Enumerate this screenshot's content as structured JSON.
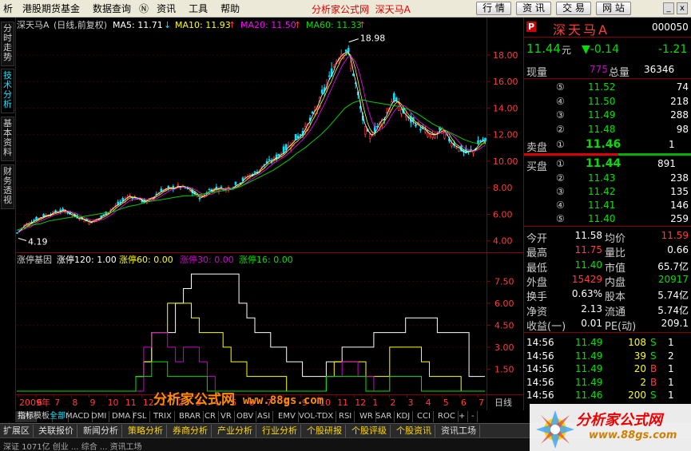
{
  "menu": {
    "items": [
      "析",
      "港股期货基金",
      "数据查询",
      "资讯",
      "工具",
      "帮助"
    ],
    "center_title": "分析家公式网",
    "center_stock": "深天马A",
    "buttons": [
      "行 情",
      "资 讯",
      "交 易",
      "网 站"
    ],
    "win_controls": [
      "_",
      "x"
    ]
  },
  "left_tabs": [
    "分时走势",
    "技术分析",
    "基本资料",
    "财务透视"
  ],
  "main_header": {
    "name": "深天马A",
    "type": "(日线,前复权)",
    "ma5": "MA5: 11.71",
    "ma10": "MA10: 11.93",
    "ma20": "MA20: 11.50",
    "ma60": "MA60: 11.33"
  },
  "price_axis": [
    "18.00",
    "16.00",
    "14.00",
    "12.00",
    "10.00",
    "8.00",
    "6.00",
    "4.00"
  ],
  "high_label": "18.98",
  "low_label": "4.19",
  "lower_header": {
    "title": "涨停基因",
    "l1": "涨停120: 1.00",
    "l2": "涨停60: 0.00",
    "l3": "涨停30: 0.00",
    "l4": "涨停16: 0.00"
  },
  "lower_axis": [
    "7.50",
    "6.00",
    "4.50",
    "3.00",
    "1.50"
  ],
  "date_axis": [
    "2009年",
    "6",
    "7",
    "8",
    "9",
    "10",
    "11",
    "12",
    "1",
    "2",
    "3",
    "4",
    "5",
    "6",
    "7",
    "8",
    "9",
    "10",
    "11",
    "12",
    "1",
    "2",
    "3",
    "4",
    "5",
    "6",
    "7"
  ],
  "period_label": "日线",
  "right_panel": {
    "code_badge": "P",
    "stock_name": "深天马A",
    "stock_code": "000050",
    "price": "11.44",
    "price_unit": "元",
    "change": "▼-0.14",
    "pct": "-1.21",
    "vol_label": "现量",
    "vol_now": "775",
    "total_label": "总量",
    "vol_total": "36346",
    "asks": [
      {
        "lv": "⑤",
        "p": "11.52",
        "v": "74"
      },
      {
        "lv": "④",
        "p": "11.50",
        "v": "218"
      },
      {
        "lv": "③",
        "p": "11.49",
        "v": "288"
      },
      {
        "lv": "②",
        "p": "11.48",
        "v": "98"
      }
    ],
    "sell1": {
      "label": "卖盘",
      "lv": "①",
      "p": "11.46",
      "v": "1"
    },
    "buy1": {
      "label": "买盘",
      "lv": "①",
      "p": "11.44",
      "v": "891"
    },
    "bids": [
      {
        "lv": "②",
        "p": "11.43",
        "v": "238"
      },
      {
        "lv": "③",
        "p": "11.42",
        "v": "135"
      },
      {
        "lv": "④",
        "p": "11.41",
        "v": "146"
      },
      {
        "lv": "⑤",
        "p": "11.40",
        "v": "259"
      }
    ],
    "stats": [
      [
        "今开",
        "11.58",
        "均价",
        "11.59"
      ],
      [
        "最高",
        "11.75",
        "量比",
        "0.66"
      ],
      [
        "最低",
        "11.40",
        "市值",
        "65.7亿"
      ],
      [
        "外盘",
        "15429",
        "内盘",
        "20917"
      ],
      [
        "换手",
        "0.63%",
        "股本",
        "5.74亿"
      ],
      [
        "净资",
        "2.13",
        "流通",
        "5.74亿"
      ],
      [
        "收益(一)",
        "0.01",
        "PE(动)",
        "209.1"
      ]
    ],
    "ticks": [
      {
        "t": "14:56",
        "p": "11.49",
        "v": "108",
        "s": "S",
        "n": "1"
      },
      {
        "t": "14:56",
        "p": "11.49",
        "v": "39",
        "s": "S",
        "n": "2"
      },
      {
        "t": "14:56",
        "p": "11.49",
        "v": "20",
        "s": "B",
        "n": "1"
      },
      {
        "t": "14:56",
        "p": "11.49",
        "v": "2",
        "s": "B",
        "n": "1"
      },
      {
        "t": "14:56",
        "p": "11.46",
        "v": "200",
        "s": "S",
        "n": "1"
      }
    ]
  },
  "tools": [
    "指标",
    "模板",
    "全部",
    "MACD",
    "DMI",
    "DMA",
    "FSL",
    "TRIX",
    "BRAR",
    "CR",
    "VR",
    "OBV",
    "ASI",
    "EMV",
    "VOL-TDX",
    "RSI",
    "WR",
    "SAR",
    "KDJ",
    "CCI",
    "ROC",
    "+",
    "-"
  ],
  "bottom_tabs": [
    "扩展区",
    "关联报价",
    "新闻分析",
    "策略分析",
    "券商分析",
    "产业分析",
    "行业分析",
    "个股研报",
    "个股评级",
    "个股资讯",
    "资讯工场"
  ],
  "status_text": "深证  1071亿  创业  ...  综合  ...  资讯工场",
  "watermark": {
    "title": "分析家公式网",
    "url": "www.88gs.com"
  },
  "logo": {
    "title": "分析家公式网",
    "url": "www.88gs.com"
  },
  "colors": {
    "up": "#ff3c3c",
    "down": "#00e000",
    "yellow": "#ffff00",
    "cyan": "#00e5ff",
    "magenta": "#d000d0",
    "ma5": "#ffffff",
    "ma10": "#ffff00",
    "ma20": "#ff00ff",
    "ma60": "#00cc00"
  },
  "chart_data": [
    {
      "type": "line",
      "title": "深天马A (日线,前复权)",
      "ylim": [
        3.5,
        19.5
      ],
      "y_ticks": [
        18,
        16,
        14,
        12,
        10,
        8,
        6,
        4
      ],
      "x": [
        0,
        10,
        20,
        30,
        40,
        50,
        60,
        70,
        80,
        90,
        100,
        110,
        120,
        130,
        140,
        150,
        160,
        170,
        180,
        190,
        200,
        210,
        220,
        230,
        240,
        250,
        260,
        270,
        280,
        290,
        300,
        310,
        320,
        330,
        340,
        350,
        360,
        370,
        380,
        390,
        400,
        410,
        415,
        420,
        425,
        430,
        435,
        440,
        450,
        460,
        470,
        480,
        490,
        500,
        510,
        520,
        530,
        540,
        550,
        560,
        570,
        580,
        585
      ],
      "series": [
        {
          "name": "Close",
          "values": [
            4.6,
            5.2,
            5.5,
            5.8,
            6.0,
            6.2,
            6.3,
            5.9,
            5.7,
            5.4,
            5.6,
            6.0,
            6.5,
            6.9,
            7.4,
            7.2,
            6.9,
            7.3,
            7.8,
            7.9,
            8.1,
            8.0,
            7.6,
            7.2,
            7.8,
            8.0,
            7.9,
            8.1,
            8.5,
            8.9,
            9.2,
            9.8,
            10.1,
            10.6,
            11.2,
            11.8,
            12.4,
            13.5,
            14.8,
            16.2,
            17.8,
            18.5,
            17.9,
            16.6,
            15.2,
            13.6,
            12.4,
            11.8,
            12.6,
            13.4,
            14.8,
            13.9,
            13.1,
            12.8,
            12.2,
            11.8,
            12.4,
            11.6,
            11.1,
            10.6,
            10.8,
            11.6,
            11.44
          ]
        },
        {
          "name": "MA60",
          "values": [
            4.8,
            5.0,
            5.2,
            5.3,
            5.5,
            5.6,
            5.7,
            5.8,
            5.8,
            5.9,
            6.0,
            6.1,
            6.2,
            6.4,
            6.6,
            6.7,
            6.9,
            7.0,
            7.1,
            7.2,
            7.3,
            7.4,
            7.4,
            7.5,
            7.6,
            7.7,
            7.8,
            7.9,
            8.1,
            8.4,
            8.7,
            9.0,
            9.3,
            9.7,
            10.1,
            10.6,
            11.0,
            11.5,
            12.0,
            12.6,
            13.3,
            14.0,
            14.2,
            14.4,
            14.5,
            14.6,
            14.6,
            14.5,
            14.4,
            14.3,
            14.2,
            14.1,
            13.9,
            13.6,
            13.2,
            12.8,
            12.5,
            12.2,
            11.9,
            11.6,
            11.4,
            11.3,
            11.33
          ]
        }
      ]
    },
    {
      "type": "line",
      "title": "涨停基因",
      "ylim": [
        0,
        8.5
      ],
      "y_ticks": [
        7.5,
        6,
        4.5,
        3,
        1.5
      ],
      "x": [
        0,
        30,
        60,
        90,
        120,
        140,
        150,
        160,
        170,
        180,
        190,
        200,
        210,
        220,
        230,
        240,
        250,
        260,
        270,
        280,
        290,
        300,
        310,
        320,
        330,
        340,
        350,
        360,
        370,
        380,
        390,
        400,
        410,
        420,
        430,
        440,
        450,
        460,
        470,
        480,
        490,
        500,
        510,
        520,
        530,
        540,
        550,
        560,
        570,
        580,
        590
      ],
      "series": [
        {
          "name": "涨停120",
          "values": [
            0,
            0,
            0,
            0,
            0,
            0,
            1,
            2,
            4,
            4,
            4,
            6,
            7,
            8,
            8,
            8,
            8,
            8,
            8,
            6,
            5,
            4,
            4,
            3,
            3,
            2,
            2,
            1,
            1,
            1,
            2,
            2,
            3,
            3,
            3,
            3,
            4,
            4,
            4,
            4,
            5,
            5,
            5,
            5,
            4,
            4,
            4,
            4,
            1,
            1,
            1
          ]
        },
        {
          "name": "涨停60",
          "values": [
            0,
            0,
            0,
            0,
            0,
            0,
            1,
            2,
            4,
            4,
            6,
            6,
            6,
            5,
            4,
            4,
            4,
            3,
            2,
            2,
            1,
            1,
            1,
            1,
            1,
            0,
            0,
            0,
            0,
            0,
            1,
            2,
            2,
            2,
            2,
            1,
            1,
            1,
            3,
            3,
            3,
            3,
            2,
            1,
            1,
            1,
            1,
            0,
            0,
            0,
            0
          ]
        },
        {
          "name": "涨停30",
          "values": [
            0,
            0,
            0,
            0,
            0,
            0,
            0,
            3,
            4,
            4,
            3,
            2,
            3,
            3,
            2,
            1,
            0,
            0,
            0,
            0,
            0,
            0,
            0,
            0,
            0,
            0,
            0,
            0,
            0,
            0,
            1,
            1,
            2,
            2,
            1,
            1,
            0,
            0,
            1,
            1,
            1,
            1,
            0,
            0,
            0,
            0,
            0,
            0,
            0,
            0,
            0
          ]
        },
        {
          "name": "涨停16",
          "values": [
            0,
            0,
            0,
            0,
            0,
            0,
            1,
            1,
            2,
            2,
            1,
            1,
            1,
            1,
            1,
            0,
            0,
            0,
            0,
            0,
            0,
            0,
            0,
            0,
            0,
            0,
            0,
            0,
            0,
            0,
            1,
            1,
            1,
            1,
            1,
            0,
            0,
            0,
            1,
            1,
            1,
            1,
            0,
            0,
            0,
            0,
            0,
            0,
            0,
            0,
            0
          ]
        }
      ]
    }
  ]
}
